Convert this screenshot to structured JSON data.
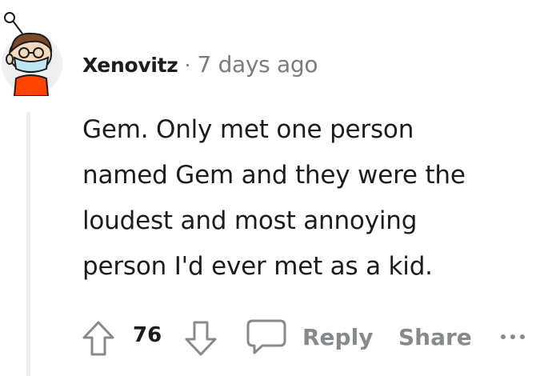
{
  "comment": {
    "author": "Xenovitz",
    "separator": "·",
    "timestamp": "7 days ago",
    "body_lines": [
      "Gem. Only met one person",
      "named Gem and they were the",
      "loudest and most annoying",
      "person I'd ever met as a kid."
    ],
    "score": "76"
  },
  "actions": {
    "reply_label": "Reply",
    "share_label": "Share"
  },
  "icons": {
    "avatar": "snoo-avatar-with-mask-and-glasses",
    "upvote": "arrow-up-icon",
    "downvote": "arrow-down-icon",
    "reply": "speech-bubble-icon",
    "more": "ellipsis-icon"
  },
  "colors": {
    "text": "#1c1c1c",
    "meta": "#7c7c7c",
    "action": "#878a8c",
    "avatar_shirt": "#ff4500"
  }
}
